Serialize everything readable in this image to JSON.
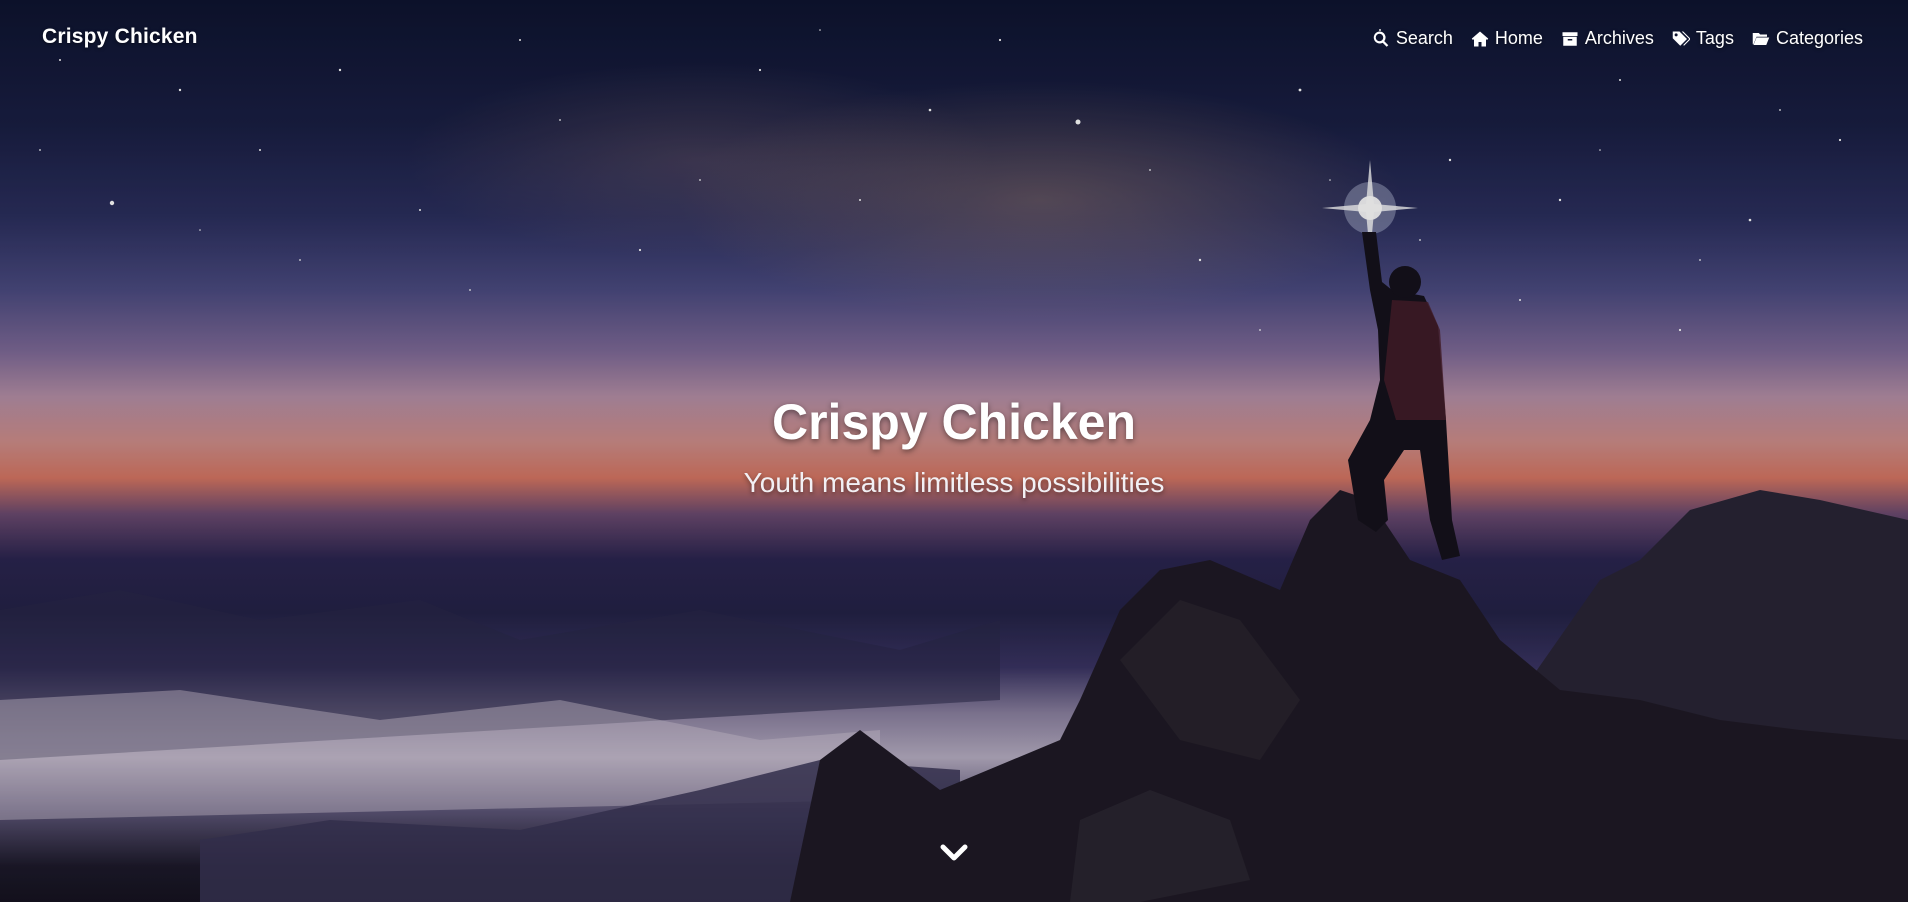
{
  "site": {
    "brand": "Crispy Chicken"
  },
  "nav": {
    "items": [
      {
        "label": "Search",
        "icon": "search-icon"
      },
      {
        "label": "Home",
        "icon": "home-icon"
      },
      {
        "label": "Archives",
        "icon": "archive-icon"
      },
      {
        "label": "Tags",
        "icon": "tags-icon"
      },
      {
        "label": "Categories",
        "icon": "folder-open-icon"
      }
    ]
  },
  "hero": {
    "title": "Crispy Chicken",
    "subtitle": "Youth means limitless possibilities",
    "scroll_icon": "chevron-down-icon"
  },
  "colors": {
    "text": "#ffffff",
    "sky_top": "#0e1430",
    "horizon_glow": "#d67663",
    "fog": "#b7aec3"
  }
}
